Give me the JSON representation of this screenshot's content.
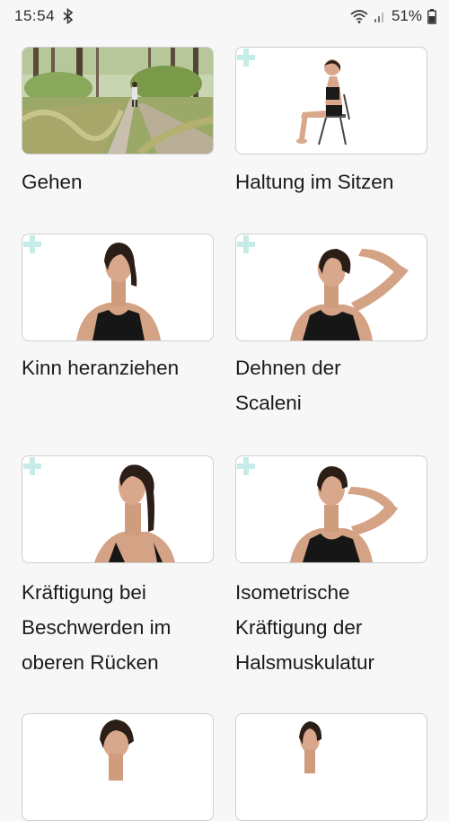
{
  "status_bar": {
    "time": "15:54",
    "battery": "51%"
  },
  "exercises": [
    {
      "title_lines": [
        "Gehen"
      ]
    },
    {
      "title_lines": [
        "Haltung im Sitzen"
      ]
    },
    {
      "title_lines": [
        "Kinn heranziehen"
      ]
    },
    {
      "title_lines": [
        "Dehnen der",
        "Scaleni"
      ]
    },
    {
      "title_lines": [
        "Kräftigung bei",
        "Beschwerden im",
        "oberen Rücken"
      ]
    },
    {
      "title_lines": [
        "Isometrische",
        "Kräftigung der",
        "Halsmuskulatur"
      ]
    },
    {
      "title_lines": []
    },
    {
      "title_lines": []
    }
  ],
  "colors": {
    "background": "#f7f7f7",
    "card_border": "#cfcfcf",
    "add_icon": "#c6ece8"
  },
  "icons": [
    "bluetooth-icon",
    "wifi-icon",
    "signal-icon",
    "battery-icon",
    "add-icon"
  ]
}
